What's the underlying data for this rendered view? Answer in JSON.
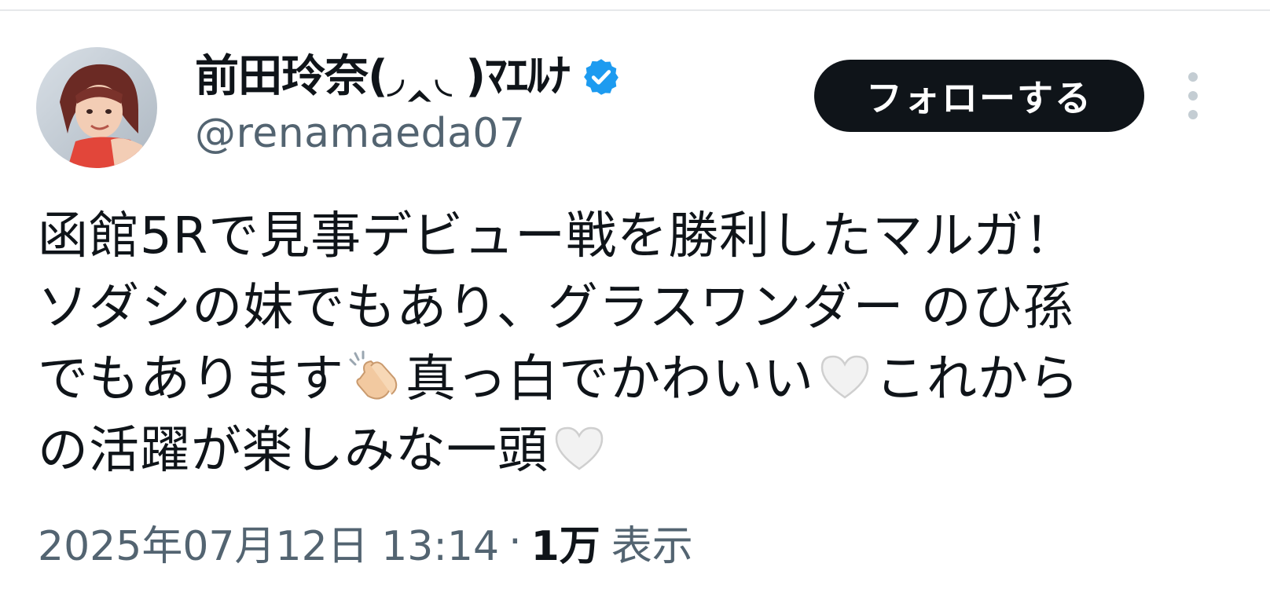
{
  "author": {
    "display_name": "前田玲奈(◞‸◟ )ﾏｴﾙﾅ",
    "handle": "@renamaeda07"
  },
  "actions": {
    "follow_label": "フォローする"
  },
  "tweet": {
    "line1": "函館5Rで見事デビュー戦を勝利したマルガ！",
    "line2": "ソダシの妹でもあり、グラスワンダー のひ孫",
    "line3a": "でもあります",
    "line3b": "真っ白でかわいい",
    "line3c": "これから",
    "line4a": "の活躍が楽しみな一頭",
    "emojis": [
      "clapping-hands-emoji",
      "white-heart-emoji",
      "white-heart-emoji"
    ]
  },
  "meta": {
    "timestamp": "2025年07月12日 13:14",
    "separator": "·",
    "views_count": "1万",
    "views_label": "表示"
  },
  "colors": {
    "verified_blue": "#1d9bf0",
    "follow_bg": "#0f1419",
    "secondary_text": "#536471"
  }
}
